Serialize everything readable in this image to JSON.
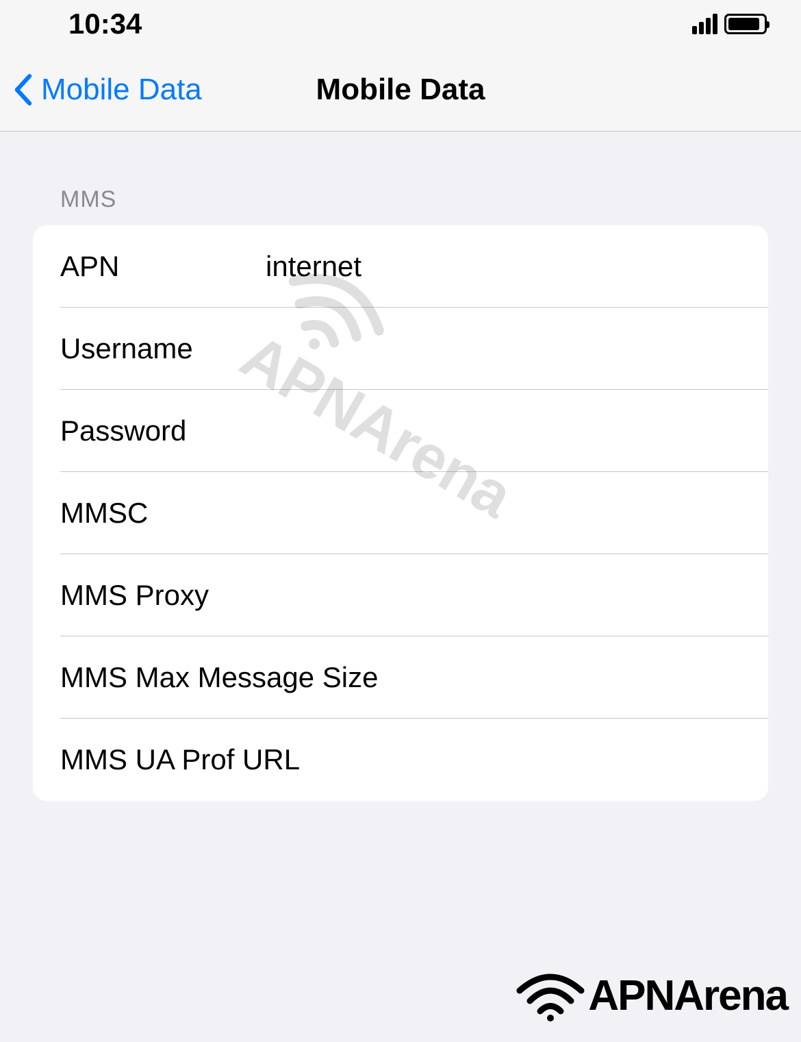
{
  "status": {
    "time": "10:34"
  },
  "nav": {
    "back_label": "Mobile Data",
    "title": "Mobile Data"
  },
  "section_header": "MMS",
  "fields": {
    "apn": {
      "label": "APN",
      "value": "internet"
    },
    "username": {
      "label": "Username",
      "value": ""
    },
    "password": {
      "label": "Password",
      "value": ""
    },
    "mmsc": {
      "label": "MMSC",
      "value": ""
    },
    "mms_proxy": {
      "label": "MMS Proxy",
      "value": ""
    },
    "mms_max_size": {
      "label": "MMS Max Message Size",
      "value": ""
    },
    "mms_ua_prof": {
      "label": "MMS UA Prof URL",
      "value": ""
    }
  },
  "watermark": "APNArena"
}
